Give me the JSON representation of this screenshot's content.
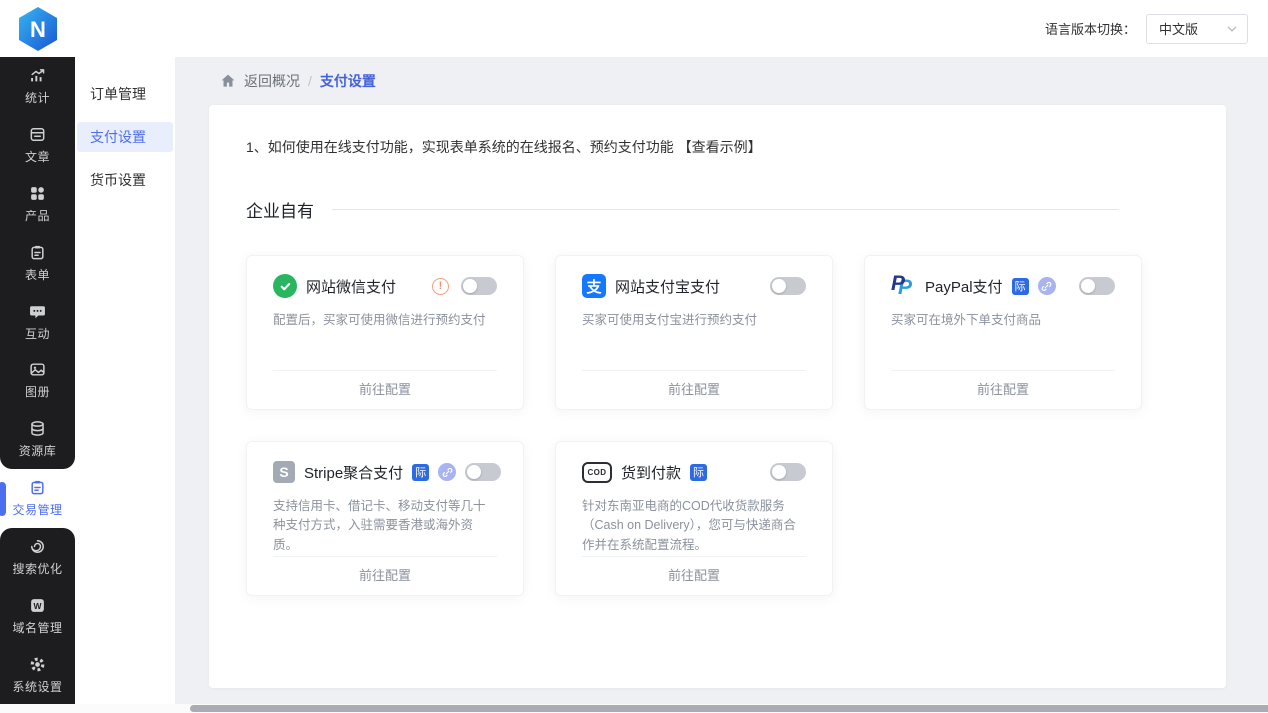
{
  "header": {
    "logo_letter": "N",
    "language_label": "语言版本切换：",
    "language_value": "中文版"
  },
  "sidebar": {
    "items": [
      {
        "icon": "stats",
        "label": "统计",
        "active": false
      },
      {
        "icon": "article",
        "label": "文章",
        "active": false
      },
      {
        "icon": "product",
        "label": "产品",
        "active": false
      },
      {
        "icon": "form",
        "label": "表单",
        "active": false
      },
      {
        "icon": "interact",
        "label": "互动",
        "active": false
      },
      {
        "icon": "gallery",
        "label": "图册",
        "active": false
      },
      {
        "icon": "resource",
        "label": "资源库",
        "active": false
      },
      {
        "icon": "trade",
        "label": "交易管理",
        "active": true
      },
      {
        "icon": "seo",
        "label": "搜索优化",
        "active": false
      },
      {
        "icon": "domain",
        "label": "域名管理",
        "active": false
      },
      {
        "icon": "settings",
        "label": "系统设置",
        "active": false
      }
    ]
  },
  "submenu": {
    "items": [
      {
        "label": "订单管理",
        "active": false
      },
      {
        "label": "支付设置",
        "active": true
      },
      {
        "label": "货币设置",
        "active": false
      }
    ]
  },
  "breadcrumb": {
    "back": "返回概况",
    "separator": "/",
    "current": "支付设置"
  },
  "main": {
    "tip": "1、如何使用在线支付功能，实现表单系统的在线报名、预约支付功能 ",
    "tip_link": "【查看示例】",
    "section_title": "企业自有",
    "warning_mark": "!",
    "intl_badge": "际",
    "cards": [
      {
        "icon": "wechat",
        "title": "网站微信支付",
        "warning": true,
        "badge": false,
        "link_icon": false,
        "enabled": false,
        "desc": "配置后，买家可使用微信进行预约支付",
        "action": "前往配置"
      },
      {
        "icon": "alipay",
        "title": "网站支付宝支付",
        "warning": false,
        "badge": false,
        "link_icon": false,
        "enabled": false,
        "desc": "买家可使用支付宝进行预约支付",
        "action": "前往配置"
      },
      {
        "icon": "paypal",
        "title": "PayPal支付",
        "warning": false,
        "badge": true,
        "link_icon": true,
        "enabled": false,
        "desc": "买家可在境外下单支付商品",
        "action": "前往配置"
      },
      {
        "icon": "stripe",
        "title": "Stripe聚合支付",
        "warning": false,
        "badge": true,
        "link_icon": true,
        "enabled": false,
        "desc": "支持信用卡、借记卡、移动支付等几十种支付方式，入驻需要香港或海外资质。",
        "action": "前往配置"
      },
      {
        "icon": "cod",
        "title": "货到付款",
        "warning": false,
        "badge": true,
        "link_icon": false,
        "enabled": false,
        "desc": "针对东南亚电商的COD代收货款服务（Cash on Delivery），您可与快递商合作并在系统配置流程。",
        "action": "前往配置"
      }
    ]
  },
  "colors": {
    "accent_blue": "#4e6ef2",
    "badge_blue": "#2d6ae3",
    "wechat_green": "#2ab561",
    "alipay_blue": "#1678ff",
    "sidebar_dark": "#1d1d1f",
    "page_bg": "#eef0f4"
  }
}
